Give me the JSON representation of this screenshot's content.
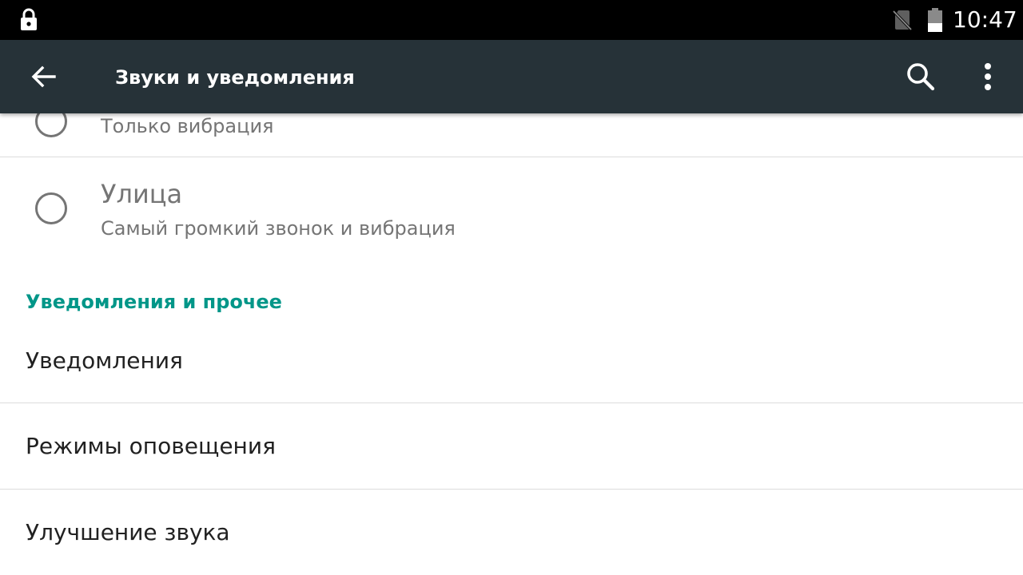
{
  "status_bar": {
    "time": "10:47",
    "icons": [
      "lock-icon",
      "no-sim-icon",
      "battery-icon"
    ]
  },
  "toolbar": {
    "title": "Звуки и уведомления",
    "icons": [
      "back-arrow-icon",
      "search-icon",
      "more-vert-icon"
    ]
  },
  "profiles": [
    {
      "title": "",
      "subtitle": "Только вибрация"
    },
    {
      "title": "Улица",
      "subtitle": "Самый громкий звонок и вибрация"
    }
  ],
  "section": {
    "header": "Уведомления и прочее",
    "items": [
      {
        "label": "Уведомления"
      },
      {
        "label": "Режимы оповещения"
      },
      {
        "label": "Улучшение звука"
      }
    ]
  },
  "colors": {
    "toolbar_bg": "#263238",
    "status_bar_bg": "#000000",
    "accent": "#009688",
    "secondary_text": "#757575",
    "primary_text": "#212121"
  }
}
